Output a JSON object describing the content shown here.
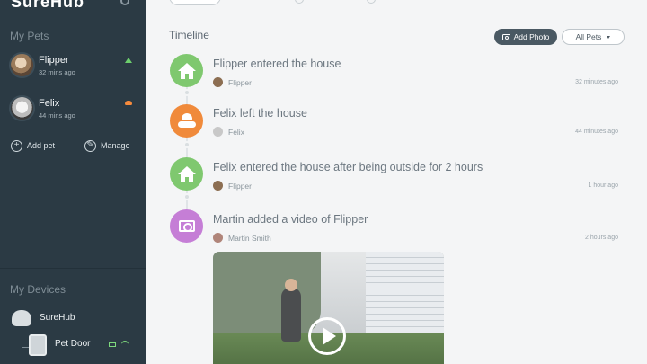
{
  "sidebar": {
    "logo": "SureHub",
    "my_pets_title": "My Pets",
    "pets": [
      {
        "name": "Flipper",
        "time": "32 mins ago",
        "status": "inside"
      },
      {
        "name": "Felix",
        "time": "44 mins ago",
        "status": "outside"
      }
    ],
    "add_pet_label": "Add pet",
    "manage_label": "Manage",
    "my_devices_title": "My Devices",
    "devices": [
      {
        "name": "SureHub"
      },
      {
        "name": "Pet Door"
      }
    ]
  },
  "main": {
    "timeline_title": "Timeline",
    "add_photo_label": "Add Photo",
    "filter_value": "All Pets",
    "events": [
      {
        "icon": "house-icon",
        "color": "#7fc86f",
        "title": "Flipper entered the house",
        "sub": "Flipper",
        "time": "32 minutes ago"
      },
      {
        "icon": "sun-cloud-icon",
        "color": "#f08a3b",
        "title": "Felix left the house",
        "sub": "Felix",
        "time": "44 minutes ago"
      },
      {
        "icon": "house-icon",
        "color": "#7fc86f",
        "title": "Felix entered the house after being outside for 2 hours",
        "sub": "Flipper",
        "time": "1 hour ago"
      },
      {
        "icon": "camera-icon",
        "color": "#c57ed6",
        "title": "Martin added a video of Flipper",
        "sub": "Martin Smith",
        "time": "2 hours ago"
      }
    ]
  },
  "colors": {
    "sidebar_bg": "#2b3a44",
    "main_bg": "#f4f5f6",
    "inside_green": "#6dcf6d",
    "outside_orange": "#f58a3d"
  }
}
